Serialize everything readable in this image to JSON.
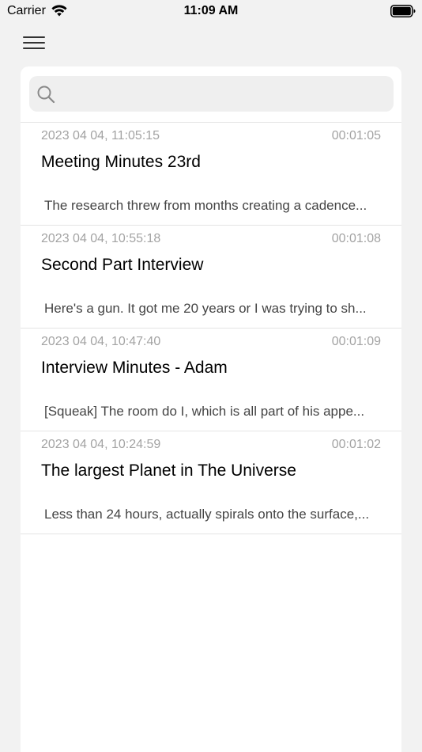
{
  "status_bar": {
    "carrier": "Carrier",
    "time": "11:09 AM",
    "wifi_icon": "wifi-icon",
    "battery_icon": "battery-icon"
  },
  "menu": {
    "icon": "hamburger-menu-icon"
  },
  "search": {
    "icon": "search-icon",
    "placeholder": "",
    "value": ""
  },
  "recordings": [
    {
      "date": "2023 04 04, 11:05:15",
      "duration": "00:01:05",
      "title": "Meeting Minutes 23rd",
      "excerpt": "The research threw from months creating a cadence..."
    },
    {
      "date": "2023 04 04, 10:55:18",
      "duration": "00:01:08",
      "title": "Second Part Interview",
      "excerpt": "Here's a gun. It got me 20 years or I was trying to sh..."
    },
    {
      "date": "2023 04 04, 10:47:40",
      "duration": "00:01:09",
      "title": "Interview Minutes - Adam",
      "excerpt": "[Squeak] The room do I, which is all part of his appe..."
    },
    {
      "date": "2023 04 04, 10:24:59",
      "duration": "00:01:02",
      "title": "The largest Planet in The Universe",
      "excerpt": "Less than 24 hours, actually spirals onto the surface,..."
    }
  ]
}
